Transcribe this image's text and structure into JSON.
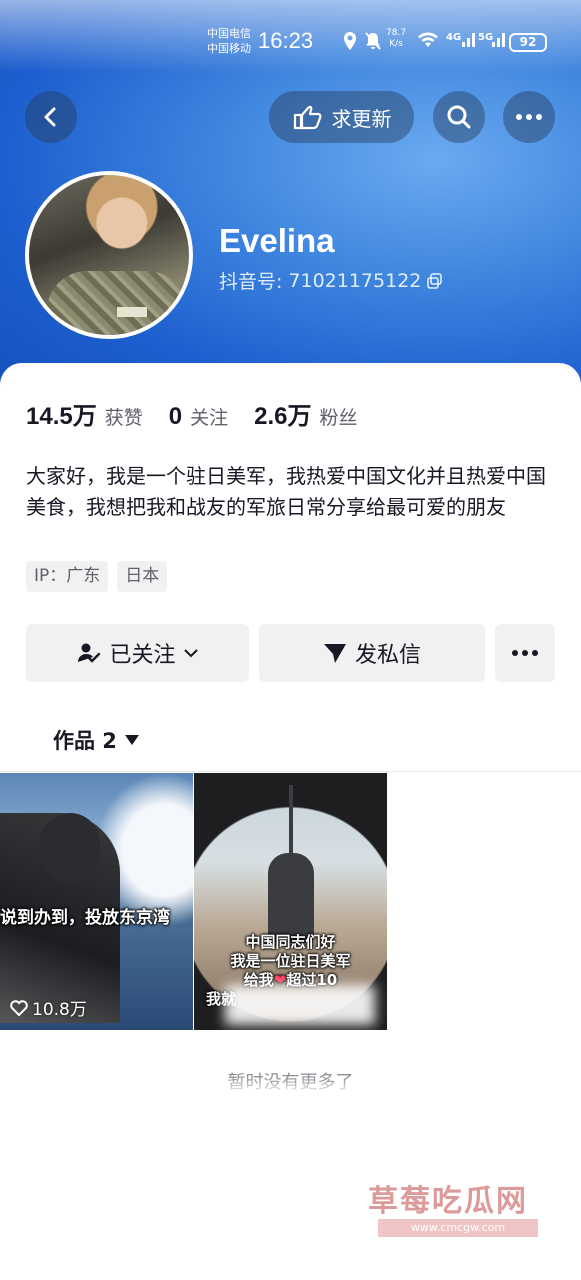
{
  "status_bar": {
    "carrier_1": "中国电信",
    "carrier_2": "中国移动",
    "time": "16:23",
    "speed_value": "78.7",
    "speed_unit": "K/s",
    "net_1": "4G",
    "net_2": "5G",
    "battery": "92"
  },
  "header": {
    "request_update_label": "求更新"
  },
  "profile": {
    "name": "Evelina",
    "id_label": "抖音号:",
    "id_value": "71021175122",
    "stats": [
      {
        "value": "14.5万",
        "label": "获赞"
      },
      {
        "value": "0",
        "label": "关注"
      },
      {
        "value": "2.6万",
        "label": "粉丝"
      }
    ],
    "bio": "大家好，我是一个驻日美军，我热爱中国文化并且热爱中国美食，我想把我和战友的军旅日常分享给最可爱的朋友",
    "tags": [
      "IP：广东",
      "日本"
    ],
    "avatar_badge": "WOTT.139"
  },
  "actions": {
    "follow_label": "已关注",
    "message_label": "发私信"
  },
  "works": {
    "tab_label": "作品 2",
    "videos": [
      {
        "caption": "说到办到，投放东京湾",
        "likes": "10.8万"
      },
      {
        "caption_lines": [
          "中国同志们好",
          "我是一位驻日美军",
          "给我",
          "超过10",
          "我就"
        ]
      }
    ],
    "no_more": "暂时没有更多了"
  },
  "watermark": {
    "brand": "草莓吃瓜网",
    "url": "www.cmcgw.com"
  }
}
